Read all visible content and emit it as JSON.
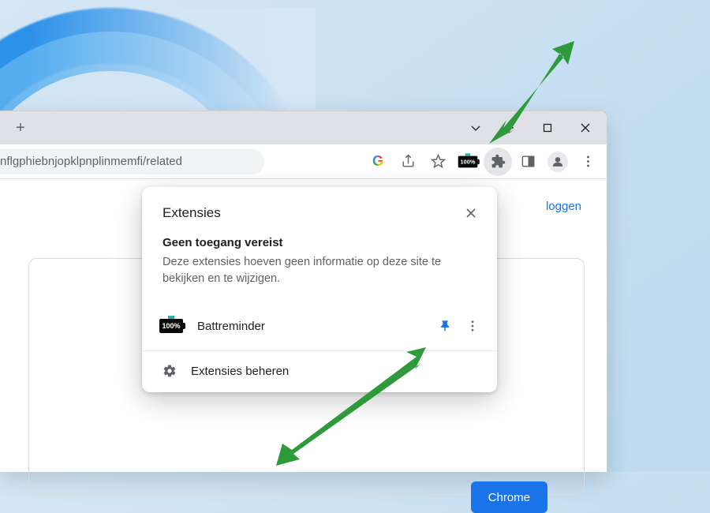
{
  "address_bar": {
    "url_fragment": "nflgphiebnjopklpnplinmemfi/related"
  },
  "toolbar": {
    "battery_pct": "100%",
    "login_text": "loggen",
    "webstore_button": "Chrome"
  },
  "popup": {
    "title": "Extensies",
    "section_title": "Geen toegang vereist",
    "section_desc": "Deze extensies hoeven geen informatie op deze site te bekijken en te wijzigen.",
    "extension": {
      "name": "Battreminder",
      "battery_pct": "100%"
    },
    "manage_label": "Extensies beheren"
  }
}
